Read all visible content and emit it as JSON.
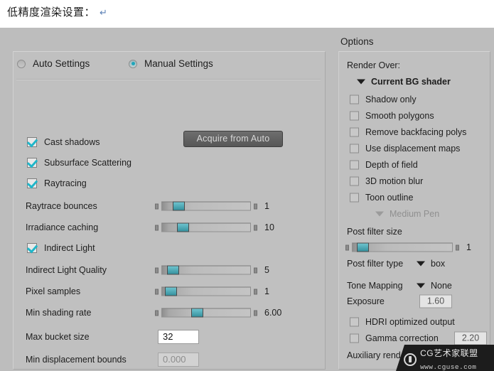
{
  "document": {
    "title": "低精度渲染设置：",
    "pilcrow": "↵"
  },
  "left_panel": {
    "modes": [
      {
        "label": "Auto Settings",
        "selected": false
      },
      {
        "label": "Manual Settings",
        "selected": true
      }
    ],
    "acquire_button": "Acquire from Auto",
    "checkboxes": [
      {
        "label": "Cast shadows",
        "checked": true
      },
      {
        "label": "Subsurface Scattering",
        "checked": true
      },
      {
        "label": "Raytracing",
        "checked": true
      }
    ],
    "indirect_light": {
      "label": "Indirect Light",
      "checked": true
    },
    "sliders": [
      {
        "label": "Raytrace bounces",
        "value": "1",
        "percent": 12
      },
      {
        "label": "Irradiance caching",
        "value": "10",
        "percent": 17
      },
      {
        "label": "Indirect Light Quality",
        "value": "5",
        "percent": 6
      },
      {
        "label": "Pixel samples",
        "value": "1",
        "percent": 3
      },
      {
        "label": "Min shading rate",
        "value": "6.00",
        "percent": 33
      }
    ],
    "fields": [
      {
        "label": "Max bucket size",
        "value": "32",
        "disabled": false
      },
      {
        "label": "Min displacement bounds",
        "value": "0.000",
        "disabled": true
      }
    ]
  },
  "right_panel": {
    "header": "Options",
    "render_over_label": "Render Over:",
    "render_over_value": "Current BG shader",
    "checkboxes": [
      {
        "label": "Shadow only",
        "checked": false
      },
      {
        "label": "Smooth polygons",
        "checked": false
      },
      {
        "label": "Remove backfacing polys",
        "checked": false
      },
      {
        "label": "Use displacement maps",
        "checked": false
      },
      {
        "label": "Depth of field",
        "checked": false
      },
      {
        "label": "3D motion blur",
        "checked": false
      },
      {
        "label": "Toon outline",
        "checked": false
      }
    ],
    "toon_pen": "Medium Pen",
    "post_filter_size_label": "Post filter size",
    "post_filter_size_value": "1",
    "post_filter_size_percent": 4,
    "post_filter_type_label": "Post filter type",
    "post_filter_type_value": "box",
    "tone_mapping_label": "Tone Mapping",
    "tone_mapping_value": "None",
    "exposure_label": "Exposure",
    "exposure_value": "1.60",
    "hdri_label": "HDRI optimized output",
    "gamma_label": "Gamma correction",
    "gamma_value": "2.20",
    "auxiliary_label": "Auxiliary render data"
  },
  "watermark": {
    "name": "CG艺术家联盟",
    "url": "www.cguse.com"
  },
  "colors": {
    "accent_teal": "#36929f",
    "check_teal": "#1fb6c9",
    "panel_bg": "#c0c0c0",
    "window_bg": "#bdbdbd"
  }
}
